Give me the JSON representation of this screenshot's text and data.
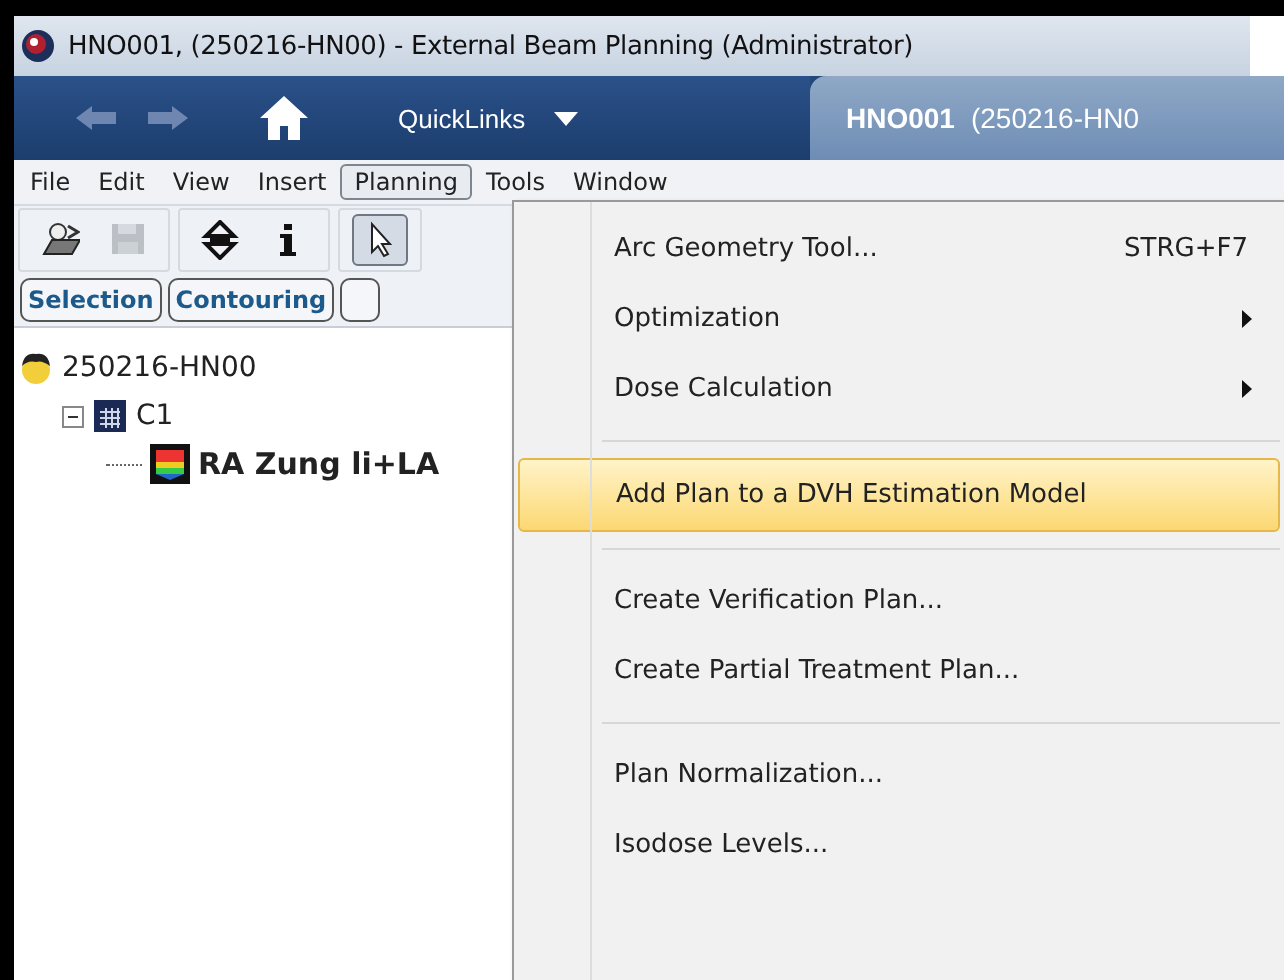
{
  "window": {
    "title": "HNO001,  (250216-HN00) - External Beam Planning (Administrator)"
  },
  "navbar": {
    "quicklinks": "QuickLinks",
    "patient_tab": {
      "id": "HNO001",
      "course": "(250216-HN0"
    }
  },
  "menubar": [
    {
      "label": "File",
      "selected": false
    },
    {
      "label": "Edit",
      "selected": false
    },
    {
      "label": "View",
      "selected": false
    },
    {
      "label": "Insert",
      "selected": false
    },
    {
      "label": "Planning",
      "selected": true
    },
    {
      "label": "Tools",
      "selected": false
    },
    {
      "label": "Window",
      "selected": false
    }
  ],
  "toolbar": [
    {
      "kind": "open",
      "disabled": false,
      "pressed": false
    },
    {
      "kind": "save",
      "disabled": true,
      "pressed": false
    },
    {
      "kind": "sep"
    },
    {
      "kind": "move",
      "disabled": false,
      "pressed": false
    },
    {
      "kind": "info",
      "disabled": false,
      "pressed": false
    },
    {
      "kind": "sep"
    },
    {
      "kind": "pointer",
      "disabled": false,
      "pressed": true
    }
  ],
  "workspace_tabs": [
    {
      "label": "Selection"
    },
    {
      "label": "Contouring"
    }
  ],
  "tree": [
    {
      "kind": "patient",
      "label": "250216-HN00",
      "children": [
        {
          "kind": "course",
          "label": "C1",
          "expanded": true,
          "children": [
            {
              "kind": "plan",
              "label": "RA Zung li+LA"
            }
          ]
        }
      ]
    }
  ],
  "dropdown": [
    {
      "kind": "item",
      "label": "Arc Geometry Tool...",
      "shortcut": "STRG+F7",
      "submenu": false,
      "highlighted": false
    },
    {
      "kind": "item",
      "label": "Optimization",
      "submenu": true,
      "highlighted": false
    },
    {
      "kind": "item",
      "label": "Dose Calculation",
      "submenu": true,
      "highlighted": false
    },
    {
      "kind": "separator"
    },
    {
      "kind": "item",
      "label": "Add Plan to a DVH Estimation Model",
      "submenu": false,
      "highlighted": true
    },
    {
      "kind": "separator"
    },
    {
      "kind": "item",
      "label": "Create Verification Plan...",
      "submenu": false,
      "highlighted": false
    },
    {
      "kind": "item",
      "label": "Create Partial Treatment Plan...",
      "submenu": false,
      "highlighted": false
    },
    {
      "kind": "separator"
    },
    {
      "kind": "item",
      "label": "Plan Normalization...",
      "submenu": false,
      "highlighted": false
    },
    {
      "kind": "item",
      "label": "Isodose Levels...",
      "submenu": false,
      "highlighted": false
    }
  ]
}
